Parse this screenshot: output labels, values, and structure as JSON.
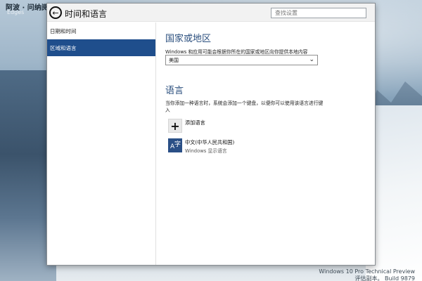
{
  "desktop": {
    "top_text": "阿波 · 问纳阅读 · ■■■■■■■■■■■■■",
    "top_sub": "Edges",
    "watermark_line1": "Windows 10 Pro Technical Preview",
    "watermark_line2": "评估副本。 Build 9879"
  },
  "window": {
    "title": "时间和语言",
    "search_placeholder": "查找设置"
  },
  "sidebar": {
    "items": [
      {
        "label": "日期和时间",
        "active": false
      },
      {
        "label": "区域和语言",
        "active": true
      }
    ]
  },
  "region": {
    "heading": "国家或地区",
    "description": "Windows 和应用可能会根据你所在的国家或地区向你提供本地内容",
    "selected_country": "美国"
  },
  "language": {
    "heading": "语言",
    "description": "当你添加一种语言时，系统会添加一个键盘，以便你可以使用该语言进行键入",
    "add_label": "添加语言",
    "items": [
      {
        "name": "中文(中华人民共和国)",
        "sub": "Windows 显示语言",
        "icon": "language-icon"
      }
    ]
  }
}
